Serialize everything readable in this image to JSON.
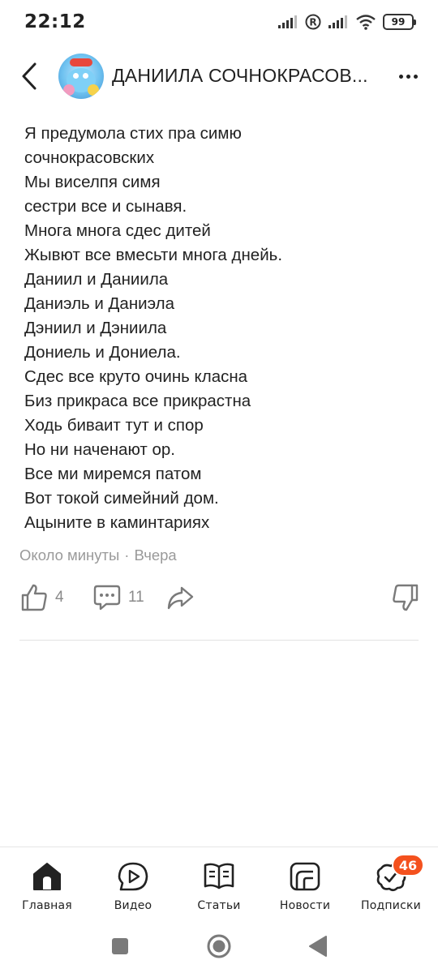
{
  "status_bar": {
    "time": "22:12",
    "battery": "99"
  },
  "header": {
    "title": "ДАНИИЛА СОЧНОКРАСОВ..."
  },
  "post": {
    "lines": [
      "Я предумола стих пра симю",
      "сочнокрасовских",
      "Мы виселпя симя",
      "сестри все и сынавя.",
      "Многа многа сдес дитей",
      "Жывют все вмесьти многа днейь.",
      "Даниил и Даниила",
      "Даниэль и Даниэла",
      "Дэниил и Дэниила",
      "Дониель и Дониела.",
      "Сдес все круто очинь класна",
      "Биз прикраса все прикрастна",
      "Ходь биваит тут и спор",
      "Но ни наченают ор.",
      "Все ми миремся патом",
      "Вот токой симейний дом.",
      "Ацыните в каминтариях"
    ],
    "read_time": "Около минуты",
    "separator": "·",
    "date": "Вчера"
  },
  "actions": {
    "likes": "4",
    "comments": "11"
  },
  "bottom_nav": {
    "items": [
      {
        "label": "Главная",
        "icon": "home-icon"
      },
      {
        "label": "Видео",
        "icon": "video-icon"
      },
      {
        "label": "Статьи",
        "icon": "articles-icon"
      },
      {
        "label": "Новости",
        "icon": "news-icon"
      },
      {
        "label": "Подписки",
        "icon": "subscriptions-icon"
      }
    ],
    "subscriptions_badge": "46"
  },
  "colors": {
    "badge": "#f4511e",
    "text": "#222222",
    "muted": "#9a9a9a"
  }
}
